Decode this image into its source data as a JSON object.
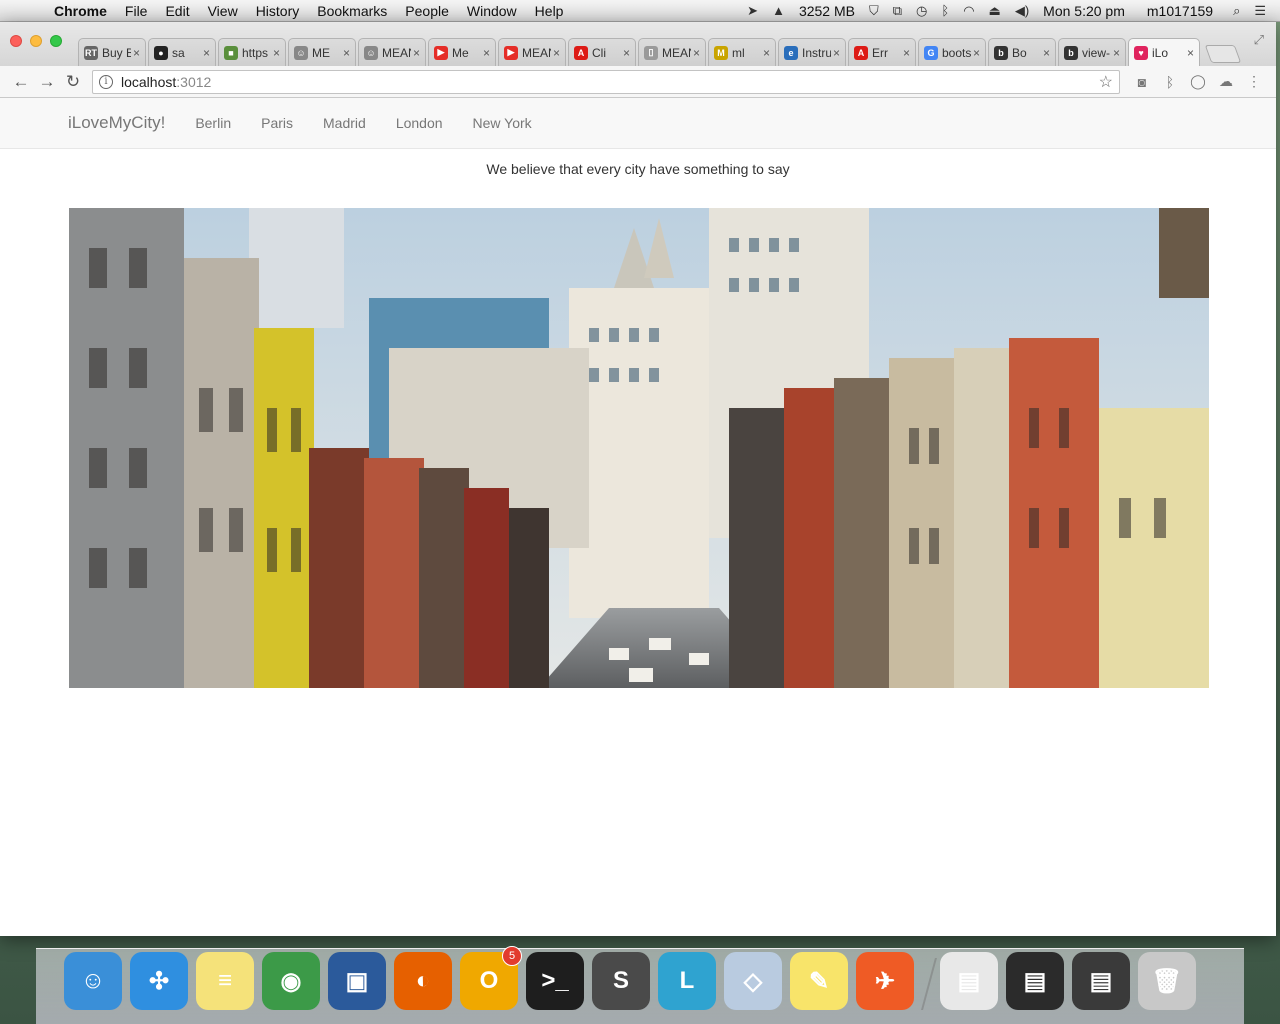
{
  "menubar": {
    "app_name": "Chrome",
    "menus": [
      "File",
      "Edit",
      "View",
      "History",
      "Bookmarks",
      "People",
      "Window",
      "Help"
    ],
    "memory": "3252 MB",
    "clock": "Mon 5:20 pm",
    "user": "m1017159"
  },
  "browser": {
    "tabs": [
      {
        "title": "Buy B",
        "icon": "rt-icon",
        "color": "#666666",
        "glyph": "RT"
      },
      {
        "title": "sa",
        "icon": "github-icon",
        "color": "#222222",
        "glyph": "●"
      },
      {
        "title": "https",
        "icon": "cube-icon",
        "color": "#5a8f3c",
        "glyph": "■"
      },
      {
        "title": "ME",
        "icon": "person-icon",
        "color": "#888888",
        "glyph": "☺"
      },
      {
        "title": "MEAN",
        "icon": "person-icon",
        "color": "#888888",
        "glyph": "☺"
      },
      {
        "title": "Me",
        "icon": "youtube-icon",
        "color": "#e52d27",
        "glyph": "▶"
      },
      {
        "title": "MEAN",
        "icon": "youtube-icon",
        "color": "#e52d27",
        "glyph": "▶"
      },
      {
        "title": "Cli",
        "icon": "angular-icon",
        "color": "#dd1b16",
        "glyph": "A"
      },
      {
        "title": "MEAN",
        "icon": "document-icon",
        "color": "#9a9a9a",
        "glyph": "▯"
      },
      {
        "title": "ml",
        "icon": "ml-icon",
        "color": "#c9a400",
        "glyph": "M"
      },
      {
        "title": "Instru",
        "icon": "e-icon",
        "color": "#2a6ebb",
        "glyph": "e"
      },
      {
        "title": "Err",
        "icon": "angular-icon",
        "color": "#dd1b16",
        "glyph": "A"
      },
      {
        "title": "boots",
        "icon": "google-icon",
        "color": "#4285f4",
        "glyph": "G"
      },
      {
        "title": "Bo",
        "icon": "bootsnipp-icon",
        "color": "#333333",
        "glyph": "b"
      },
      {
        "title": "view-",
        "icon": "bootsnipp-icon",
        "color": "#333333",
        "glyph": "b"
      },
      {
        "title": "iLo",
        "icon": "ilovemycity-icon",
        "color": "#e0245e",
        "glyph": "♥",
        "active": true
      }
    ],
    "url_host": "localhost",
    "url_port": ":3012"
  },
  "site": {
    "brand": "iLoveMyCity!",
    "nav_links": [
      "Berlin",
      "Paris",
      "Madrid",
      "London",
      "New York"
    ],
    "tagline": "We believe that every city have something to say",
    "hero_alt": "New York Chinatown street view"
  },
  "dock": {
    "apps": [
      {
        "name": "finder-icon",
        "color": "#3a8fd8",
        "glyph": "☺"
      },
      {
        "name": "safari-icon",
        "color": "#2f8fe0",
        "glyph": "✣"
      },
      {
        "name": "stickies-notes-icon",
        "color": "#f5e27a",
        "glyph": "≡"
      },
      {
        "name": "chrome-icon",
        "color": "#3c9a48",
        "glyph": "◉"
      },
      {
        "name": "virtualbox-icon",
        "color": "#2b5a9b",
        "glyph": "▣"
      },
      {
        "name": "firefox-icon",
        "color": "#e66000",
        "glyph": "◐"
      },
      {
        "name": "outlook-icon",
        "color": "#f0a800",
        "glyph": "O",
        "badge": "5"
      },
      {
        "name": "terminal-icon",
        "color": "#1e1e1e",
        "glyph": ">_"
      },
      {
        "name": "sublime-text-icon",
        "color": "#4a4a4a",
        "glyph": "S"
      },
      {
        "name": "lync-icon",
        "color": "#2fa3d0",
        "glyph": "L"
      },
      {
        "name": "cube-app-icon",
        "color": "#b9cbe0",
        "glyph": "◇"
      },
      {
        "name": "stickies-icon",
        "color": "#f8e46a",
        "glyph": "✎"
      },
      {
        "name": "postman-icon",
        "color": "#ef5b25",
        "glyph": "✈"
      }
    ],
    "minimized": [
      {
        "name": "minimized-window-1-icon",
        "color": "#e8e8e8",
        "glyph": "▤"
      },
      {
        "name": "minimized-window-2-icon",
        "color": "#2b2b2b",
        "glyph": "▤"
      },
      {
        "name": "minimized-window-3-icon",
        "color": "#3a3a3a",
        "glyph": "▤"
      },
      {
        "name": "trash-icon",
        "color": "#c8c8c8",
        "glyph": "🗑"
      }
    ]
  }
}
